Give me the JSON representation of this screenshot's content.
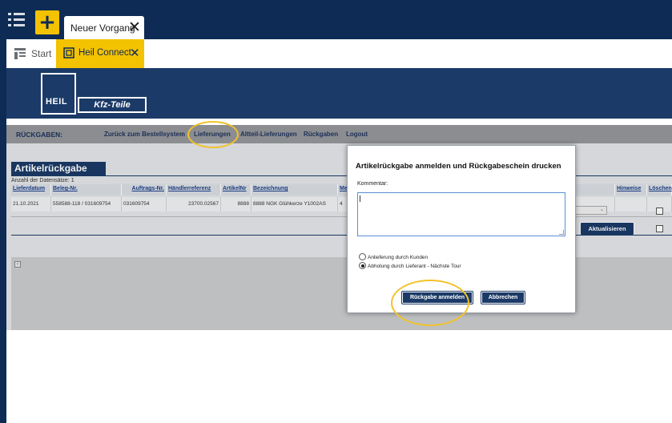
{
  "app": {
    "tabs": [
      {
        "label": "Neuer Vorgang",
        "close": "✕"
      }
    ],
    "add_label": "+",
    "subtabs": [
      {
        "label": "Start"
      },
      {
        "label": "Heil Connect",
        "close": "✕"
      }
    ]
  },
  "embed": {
    "logo": {
      "left_text": "HEIL",
      "right_text": "Kfz-Teile"
    },
    "nav": {
      "section": "RÜCKGABEN:",
      "links": [
        "Zurück zum Bestellsystem",
        "Lieferungen",
        "Altteil-Lieferungen",
        "Rückgaben",
        "Logout"
      ]
    },
    "page_title": "Artikelrückgabe",
    "record_count": "Anzahl der Datensätze: 1",
    "table": {
      "headers": [
        "Lieferdatum",
        "Beleg-Nr.",
        "Auftrags-Nr.",
        "Händlerreferenz",
        "ArtikelNr",
        "Bezeichnung",
        "Men",
        "Hinweise",
        "Löschen"
      ],
      "rows": [
        [
          "21.10.2021",
          "558588-118 / 031609754",
          "031609754",
          "23700.02567",
          "8888",
          "8888 NGK Glühkerze Y1002AS",
          "4"
        ]
      ]
    },
    "refresh_button": "Aktualisieren"
  },
  "modal": {
    "title": "Artikelrückgabe anmelden und Rückgabeschein drucken",
    "comment_label": "Kommentar:",
    "comment_value": "",
    "options": [
      {
        "label": "Anlieferung durch Kunden",
        "checked": false
      },
      {
        "label": "Abholung durch Lieferant - Nächste Tour",
        "checked": true
      }
    ],
    "submit_button": "Rückgabe anmelden",
    "cancel_button": "Abbrechen"
  },
  "colors": {
    "navy": "#0d2b55",
    "accent_yellow": "#f3c200",
    "highlight": "#f3c22a"
  }
}
